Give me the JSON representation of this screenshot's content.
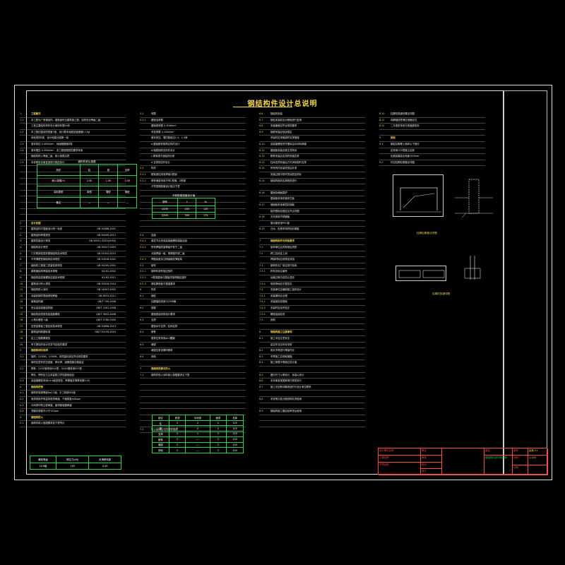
{
  "drawing": {
    "title": "钢结构件设计总说明",
    "colors": {
      "frame": "#e0e0e0",
      "text": "#e8e8e8",
      "heading": "#f4d44c",
      "table": "#2fd158",
      "titleblock": "#ff4a4a"
    }
  },
  "columns": [
    [
      {
        "n": "1",
        "t": "工程概况",
        "h": true
      },
      {
        "n": "1.1",
        "t": "本工程为厂房钢结构，建筑面积见建筑施工图，结构安全等级二级"
      },
      {
        "n": "",
        "t": "工程主要结构构件设计使用年限50年"
      },
      {
        "n": "1.2",
        "t": "本工程抗震设防烈度7度，设计基本地震加速度值0.10g"
      },
      {
        "n": "",
        "t": "场地类别II类，设计地震分组第一组"
      },
      {
        "n": "1.3",
        "t": "基本风压 0.45kN/m²，地面粗糙度B类"
      },
      {
        "n": "1.4",
        "t": "基本雪压 0.35kN/m²，本工程按照规范要求采用"
      },
      {
        "n": "",
        "t": "钢结构防火等级二级，耐火极限见表"
      },
      {
        "n": "1.5",
        "t": "本说明未尽事宜按现行规范执行"
      },
      {
        "n": "",
        "t": ""
      },
      {
        "n": "",
        "t": ""
      },
      {
        "n": "",
        "t": ""
      },
      {
        "n": "",
        "t": ""
      },
      {
        "n": "",
        "t": ""
      },
      {
        "n": "",
        "t": ""
      },
      {
        "n": "",
        "t": ""
      },
      {
        "n": "",
        "t": ""
      },
      {
        "n": "",
        "t": ""
      },
      {
        "n": "2",
        "t": "设计依据",
        "h": true
      },
      {
        "n": "1.",
        "t": "建筑结构可靠度设计统一标准",
        "r": "GB 50068-2001"
      },
      {
        "n": "2.",
        "t": "建筑结构荷载规范",
        "r": "GB 50009-2012"
      },
      {
        "n": "3.",
        "t": "建筑抗震设计规范",
        "r": "GB 50011-2010(2016)"
      },
      {
        "n": "4.",
        "t": "钢结构设计规范",
        "r": "GB 50017-2003"
      },
      {
        "n": "5.",
        "t": "门式刚架轻型房屋钢结构技术规范",
        "r": "GB 51022-2015"
      },
      {
        "n": "6.",
        "t": "冷弯薄壁型钢结构技术规范",
        "r": "GB 50018-2002"
      },
      {
        "n": "7.",
        "t": "钢结构工程施工质量验收规范",
        "r": "GB 50205-2001"
      },
      {
        "n": "8.",
        "t": "建筑钢结构焊接技术规程",
        "r": "JGJ 81-2002"
      },
      {
        "n": "9.",
        "t": "钢结构高强度螺栓连接技术规程",
        "r": "JGJ 82-2011"
      },
      {
        "n": "10.",
        "t": "建筑设计防火规范",
        "r": "GB 50016-2014"
      },
      {
        "n": "11.",
        "t": "钢结构防火涂料",
        "r": "GB 14907-2002"
      },
      {
        "n": "12.",
        "t": "涂装前钢材表面锈蚀等级",
        "r": "GB 8923-2011"
      },
      {
        "n": "13.",
        "t": "碳素结构钢",
        "r": "GB/T 700-2006"
      },
      {
        "n": "14.",
        "t": "低合金高强度结构钢",
        "r": "GB/T 1591-2008"
      },
      {
        "n": "15.",
        "t": "钢结构用扭剪型高强度螺栓",
        "r": "GB/T 3632-2008"
      },
      {
        "n": "16.",
        "t": "六角头螺栓 C级",
        "r": "GB/T 5780-2000"
      },
      {
        "n": "17.",
        "t": "压型金属板工程应用技术规范",
        "r": "GB 50896-2013"
      },
      {
        "n": "18.",
        "t": "建筑结构制图标准",
        "r": "GB/T 50105-2010"
      },
      {
        "n": "19.",
        "t": "岩土工程勘察报告"
      },
      {
        "n": "20.",
        "t": "甲方提供的设计任务书及相关要求"
      },
      {
        "n": "3",
        "t": "钢结构材料说明",
        "h": true
      },
      {
        "n": "3.1",
        "t": "钢材：Q235B、Q345B，其质量标准应符合规范要求"
      },
      {
        "n": "",
        "t": "钢材应具有抗拉强度、伸长率、屈服强度合格保证"
      },
      {
        "n": "3.2",
        "t": "焊条：Q235钢采用E43型，Q345钢采用E50型"
      },
      {
        "n": "",
        "t": "焊丝、焊剂应与主体金属力学性能相适应"
      },
      {
        "n": "3.3",
        "t": "高强度螺栓采用10.9级扭剪型，摩擦面抗滑移系数0.45"
      },
      {
        "n": "4",
        "t": "钢结构防锈",
        "h": true
      },
      {
        "n": "4.1",
        "t": "钢构件除锈等级Sa2.5级，手工除锈St3级"
      },
      {
        "n": "4.2",
        "t": "底漆采用环氧富锌底漆两道，干膜厚度≥60μm"
      },
      {
        "n": "4.3",
        "t": "中间漆环氧云铁两道，面漆聚氨酯两道"
      },
      {
        "n": "4.4",
        "t": "漆膜总厚度不小于125μm"
      },
      {
        "n": "5",
        "t": "钢结构防火",
        "h": true
      },
      {
        "n": "5.1",
        "t": "钢构件耐火极限要求如下表所示"
      }
    ],
    [
      {
        "n": "5.2",
        "t": "荷载"
      },
      {
        "n": "5.2.1",
        "t": "屋面活荷载"
      },
      {
        "n": "",
        "t": "屋面恒荷载 0.30kN/m²"
      },
      {
        "n": "",
        "t": "吊挂荷载 0.15kN/m²"
      },
      {
        "n": "",
        "t": "基本风压、雪压取值见1.3、1.4条"
      },
      {
        "n": "",
        "t": "a.屋面檩条按简支构件设计"
      },
      {
        "n": "",
        "t": "b.墙梁按简支构件设计"
      },
      {
        "n": "",
        "t": "c.刚架按平面结构分析"
      },
      {
        "n": "",
        "t": "d.支撑按拉杆设计"
      },
      {
        "n": "5.3",
        "t": "构件"
      },
      {
        "n": "5.3.1",
        "t": "刚架梁柱采用焊接H型钢"
      },
      {
        "n": "5.3.2",
        "t": "檩条墙梁采用冷弯C型钢、Z型钢"
      },
      {
        "n": "",
        "t": "冷弯型钢强度设计值见下表"
      },
      {
        "n": "",
        "t": ""
      },
      {
        "n": "",
        "t": ""
      },
      {
        "n": "",
        "t": ""
      },
      {
        "n": "",
        "t": ""
      },
      {
        "n": "",
        "t": ""
      },
      {
        "n": "",
        "t": ""
      },
      {
        "n": "",
        "t": ""
      },
      {
        "n": "5.4",
        "t": "连接"
      },
      {
        "n": "5.4.1",
        "t": "梁柱节点采用高强度螺栓端板连接"
      },
      {
        "n": "5.4.2",
        "t": "所有焊缝质量等级不低于二级"
      },
      {
        "n": "",
        "t": "对接焊缝一级，角焊缝外观二级"
      },
      {
        "n": "5.4.3",
        "t": "焊缝高度未注明者取较薄板厚"
      },
      {
        "n": "5.5",
        "t": "制作"
      },
      {
        "n": "5.5.1",
        "t": "钢构件制作前应放样"
      },
      {
        "n": "5.5.2",
        "t": "H型钢翼缘与腹板拼接焊缝应错开"
      },
      {
        "n": "5.5.3",
        "t": "钢柱脚底板平整度要求"
      },
      {
        "n": "6",
        "t": "构件"
      },
      {
        "n": "6.1",
        "t": "钢柱"
      },
      {
        "n": "",
        "t": "柱脚锚栓采用Q235B钢"
      },
      {
        "n": "6.2",
        "t": "钢梁"
      },
      {
        "n": "",
        "t": "屋面梁起拱按设计要求"
      },
      {
        "n": "6.3",
        "t": "支撑"
      },
      {
        "n": "",
        "t": "屋面水平支撑、柱间支撑"
      },
      {
        "n": "6.4",
        "t": "檩条"
      },
      {
        "n": "",
        "t": "檩条拉条采用φ12圆钢"
      },
      {
        "n": "6.5",
        "t": "墙梁"
      },
      {
        "n": "",
        "t": "墙梁拉条设置同檩条"
      },
      {
        "n": "6.6",
        "t": "其他"
      },
      {
        "n": "",
        "t": ""
      },
      {
        "n": "7",
        "t": "钢结构防腐与防火",
        "h": true
      },
      {
        "n": "7.1",
        "t": "钢构件防火涂料耐火极限要求见下表"
      },
      {
        "n": "",
        "t": ""
      },
      {
        "n": "",
        "t": ""
      },
      {
        "n": "",
        "t": ""
      },
      {
        "n": "",
        "t": ""
      },
      {
        "n": "",
        "t": ""
      },
      {
        "n": "",
        "t": ""
      },
      {
        "n": "",
        "t": ""
      },
      {
        "n": "",
        "t": ""
      },
      {
        "n": "7.2",
        "t": "防火涂料应与防锈漆相容"
      }
    ],
    [
      {
        "n": "6.6",
        "t": "钢结构安装"
      },
      {
        "n": "6.7",
        "t": "钢柱安装前应对基础进行复测"
      },
      {
        "n": "6.8",
        "t": "安装偏差应符合规范要求"
      },
      {
        "n": "6.9",
        "t": "钢梁吊装应保证稳定"
      },
      {
        "n": "",
        "t": "吊装时应采取临时支撑措施"
      },
      {
        "n": "6.10",
        "t": "高强度螺栓终拧顺序由中间向两端"
      },
      {
        "n": "6.11",
        "t": "屋面板安装应顺主导风向"
      },
      {
        "n": "6.12",
        "t": "檩条安装后应及时安装拉条"
      },
      {
        "n": "6.13",
        "t": "柱间支撑安装后方可拆除临时支撑"
      },
      {
        "n": "6.14",
        "t": "所有构件安装完成后补漆"
      },
      {
        "n": "",
        "t": "安装过程中损坏的涂层应修补"
      },
      {
        "n": "6.15",
        "t": "钢结构验收应按规范进行"
      },
      {
        "n": "",
        "t": ""
      },
      {
        "n": "6.16",
        "t": "屋面及墙面围护"
      },
      {
        "n": "",
        "t": "屋面板采用彩钢夹芯板"
      },
      {
        "n": "6.17",
        "t": "墙面板采用单层彩钢板"
      },
      {
        "n": "",
        "t": "板材搭接及固定见节点详图"
      },
      {
        "n": "6.18",
        "t": "天沟采用不锈钢板"
      },
      {
        "n": "",
        "t": "落水管采用PVC管"
      },
      {
        "n": "6.19",
        "t": "泛水、包角采用同色彩钢板"
      },
      {
        "n": "",
        "t": ""
      },
      {
        "n": "7",
        "t": "钢结构制作与安装要求",
        "h": true
      },
      {
        "n": "7.1",
        "t": "制作单位应具有相应资质"
      },
      {
        "n": "7.2",
        "t": "焊工应持证上岗"
      },
      {
        "n": "",
        "t": "焊接材料应按规定烘焙"
      },
      {
        "n": "7.3",
        "t": "钢构件出厂前应进行验收"
      },
      {
        "n": "7.3.1",
        "t": "构件应标注编号"
      },
      {
        "n": "",
        "t": "运输过程中应防止变形"
      },
      {
        "n": "7.3.2",
        "t": "堆放场地应平整坚实"
      },
      {
        "n": "7.4",
        "t": "安装单位应编制施工组织设计"
      },
      {
        "n": "7.4.1",
        "t": "安装顺序应合理"
      },
      {
        "n": "7.4.2",
        "t": "安装前检查基础"
      },
      {
        "n": "7.4.3",
        "t": "安装时应及时校正"
      },
      {
        "n": "7.4.4",
        "t": "螺栓连接检查"
      },
      {
        "n": "7.5",
        "t": "其他"
      },
      {
        "n": "",
        "t": ""
      },
      {
        "n": "8",
        "t": "钢结构施工注意事项",
        "h": true
      },
      {
        "n": "8.1",
        "t": "施工中应注意安全"
      },
      {
        "n": "",
        "t": "高空作业应系安全带"
      },
      {
        "n": "8.2",
        "t": "雨天不得进行焊接作业"
      },
      {
        "n": "8.3",
        "t": "冬季施工应采取措施"
      },
      {
        "n": "8.4",
        "t": "施工荷载不得超过设计值"
      },
      {
        "n": "",
        "t": ""
      },
      {
        "n": "8.5",
        "t": "图中尺寸以毫米计，标高以米计"
      },
      {
        "n": "8.6",
        "t": "未尽事宜按国家现行规范执行"
      },
      {
        "n": "8.7",
        "t": "施工中如有问题请及时与设计单位联系"
      },
      {
        "n": "",
        "t": ""
      },
      {
        "n": "8.8",
        "t": "本说明与各分图说明共同使用"
      },
      {
        "n": "",
        "t": ""
      },
      {
        "n": "8.9",
        "t": "钢结构施工图应经审查后使用"
      },
      {
        "n": "",
        "t": ""
      },
      {
        "n": "",
        "t": ""
      }
    ],
    [
      {
        "n": "8.10",
        "t": "柱脚抗剪键设置见详图"
      },
      {
        "n": "8.11",
        "t": "地脚锚栓预埋应准确定位"
      },
      {
        "n": "8.12",
        "t": "二次灌浆采用无收缩灌浆料"
      },
      {
        "n": "",
        "t": ""
      },
      {
        "n": "9",
        "t": "其他",
        "h": true
      },
      {
        "n": "9.1",
        "t": "钢柱柱脚埋入地坪以下部分"
      },
      {
        "n": "",
        "t": "应采用C20混凝土包裹"
      },
      {
        "n": "",
        "t": "包裹高度高出地面150mm"
      },
      {
        "n": "9.2",
        "t": "详见柱脚包裹做法详图"
      }
    ]
  ],
  "tables": {
    "fire": {
      "caption": "钢构件耐火极限",
      "rows": [
        [
          "构件",
          "柱",
          "梁",
          "支撑"
        ],
        [
          "耐火极限(h)",
          "2.50",
          "1.50",
          "1.00"
        ],
        [
          "涂料类型",
          "厚型",
          "薄型",
          "薄型"
        ],
        [
          "备注",
          "—",
          "—",
          "—"
        ]
      ]
    },
    "steel": {
      "caption": "冷弯型钢强度设计值",
      "rows": [
        [
          "钢号",
          "f",
          "fv"
        ],
        [
          "Q235",
          "205",
          "120"
        ],
        [
          "Q345",
          "300",
          "175"
        ]
      ]
    },
    "bolt": {
      "rows": [
        [
          "螺栓等级",
          "预拉力(kN)",
          "抗滑移系数"
        ],
        [
          "10.9级",
          "155",
          "0.45"
        ]
      ]
    },
    "coat": {
      "rows": [
        [
          "部位",
          "底漆",
          "中间漆",
          "面漆",
          "总厚"
        ],
        [
          "柱",
          "2",
          "2",
          "2",
          "125"
        ],
        [
          "梁",
          "2",
          "2",
          "2",
          "125"
        ],
        [
          "支撑",
          "2",
          "1",
          "2",
          "110"
        ],
        [
          "檩条",
          "2",
          "—",
          "2",
          "100"
        ],
        [
          "墙梁",
          "2",
          "—",
          "2",
          "100"
        ],
        [
          "其他",
          "2",
          "—",
          "2",
          "100"
        ]
      ]
    }
  },
  "details": {
    "d1_caption": "柱脚包裹做法详图",
    "d2_caption": "柱脚抗剪键详图"
  },
  "titleblock": {
    "c1": "设计单位名称",
    "c2": "工程名称",
    "c3": "子项名称",
    "c4": "审定",
    "c5": "审核",
    "c6": "校对",
    "c7": "设计",
    "c8": "图名",
    "c9": "钢结构件设计总说明",
    "c10": "图号",
    "c11": "结施-01",
    "c12": "比例",
    "c13": "1:100",
    "c14": "日期"
  }
}
